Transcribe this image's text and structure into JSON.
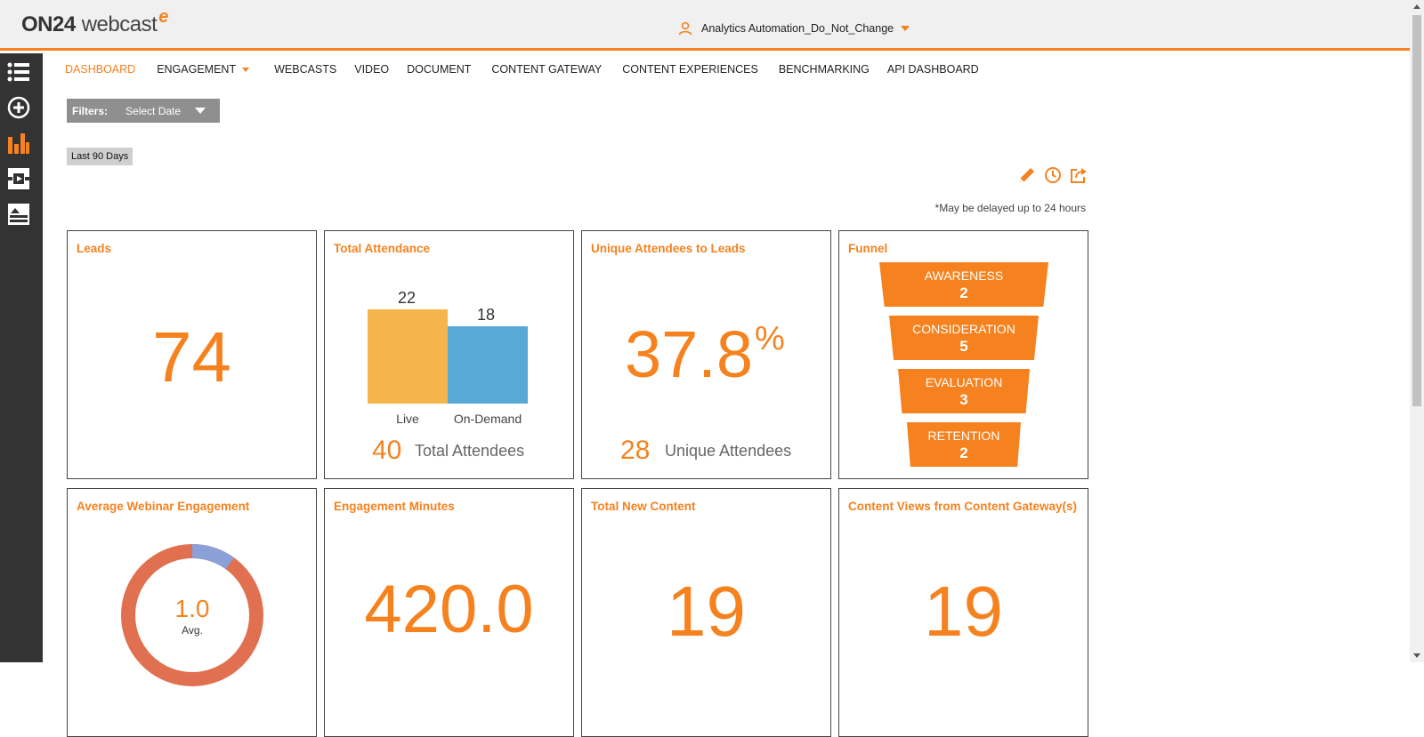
{
  "header": {
    "logo_on": "ON24",
    "logo_web": "webcast",
    "logo_e": "e",
    "account_name": "Analytics Automation_Do_Not_Change"
  },
  "sidebar": {
    "items": [
      {
        "icon": "list-icon"
      },
      {
        "icon": "add-circle-icon"
      },
      {
        "icon": "bar-chart-icon"
      },
      {
        "icon": "content-icon"
      },
      {
        "icon": "media-icon"
      }
    ]
  },
  "nav": {
    "items": [
      {
        "label": "DASHBOARD",
        "active": true
      },
      {
        "label": "ENGAGEMENT",
        "dropdown": true
      },
      {
        "label": "WEBCASTS"
      },
      {
        "label": "VIDEO"
      },
      {
        "label": "DOCUMENT"
      },
      {
        "label": "CONTENT GATEWAY"
      },
      {
        "label": "CONTENT EXPERIENCES"
      },
      {
        "label": "BENCHMARKING"
      },
      {
        "label": "API DASHBOARD"
      }
    ]
  },
  "filters": {
    "label": "Filters:",
    "value": "Select Date",
    "chip": "Last 90 Days"
  },
  "delay_note": "*May be delayed up to 24 hours",
  "cards": {
    "leads": {
      "title": "Leads",
      "value": "74"
    },
    "attendance": {
      "title": "Total Attendance",
      "live_label": "Live",
      "live_value": "22",
      "od_label": "On-Demand",
      "od_value": "18",
      "total_value": "40",
      "total_label": "Total Attendees"
    },
    "unique_to_leads": {
      "title": "Unique Attendees to Leads",
      "value": "37.8",
      "unit": "%",
      "sub_value": "28",
      "sub_label": "Unique Attendees"
    },
    "funnel": {
      "title": "Funnel",
      "stages": [
        {
          "label": "AWARENESS",
          "value": "2"
        },
        {
          "label": "CONSIDERATION",
          "value": "5"
        },
        {
          "label": "EVALUATION",
          "value": "3"
        },
        {
          "label": "RETENTION",
          "value": "2"
        }
      ]
    },
    "avg_engagement": {
      "title": "Average Webinar Engagement",
      "value": "1.0",
      "sub": "Avg.",
      "fraction": 0.1
    },
    "engagement_minutes": {
      "title": "Engagement Minutes",
      "value": "420.0"
    },
    "total_new_content": {
      "title": "Total New Content",
      "value": "19"
    },
    "content_views": {
      "title": "Content Views from Content Gateway(s)",
      "value": "19"
    }
  },
  "colors": {
    "accent": "#f5821f",
    "live_bar": "#f4b64a",
    "od_bar": "#59a9d6",
    "donut_main": "#e07050",
    "donut_part": "#8aa0d6"
  }
}
